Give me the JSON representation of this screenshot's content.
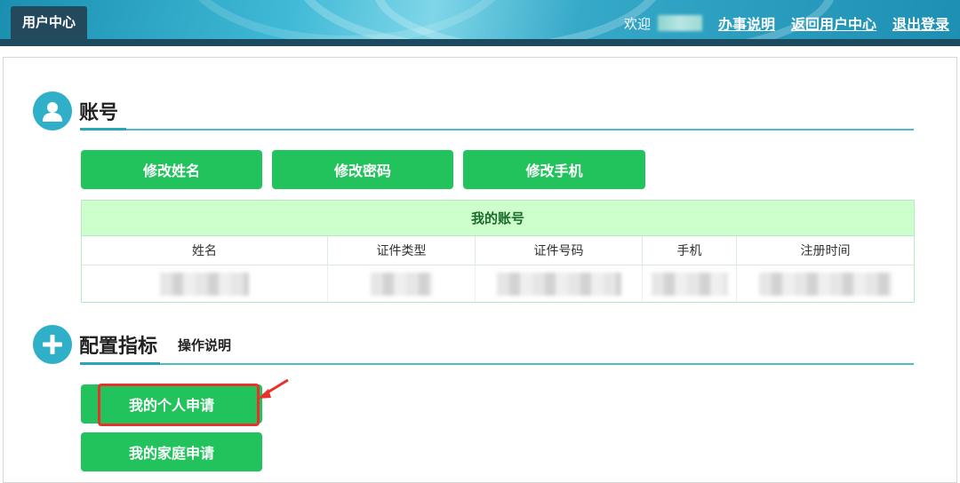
{
  "header": {
    "brand": "用户中心",
    "welcome_label": "欢迎",
    "links": [
      "办事说明",
      "返回用户中心",
      "退出登录"
    ]
  },
  "account_section": {
    "title": "账号",
    "buttons": [
      "修改姓名",
      "修改密码",
      "修改手机"
    ],
    "table": {
      "title": "我的账号",
      "columns": [
        "姓名",
        "证件类型",
        "证件号码",
        "手机",
        "注册时间"
      ]
    }
  },
  "config_section": {
    "title": "配置指标",
    "help_link": "操作说明",
    "buttons": [
      "我的个人申请",
      "我的家庭申请"
    ]
  },
  "colors": {
    "accent_teal": "#2fb0c8",
    "button_green": "#22c35c",
    "table_header_green": "#ccffcc",
    "highlight_red": "#e8312c"
  }
}
